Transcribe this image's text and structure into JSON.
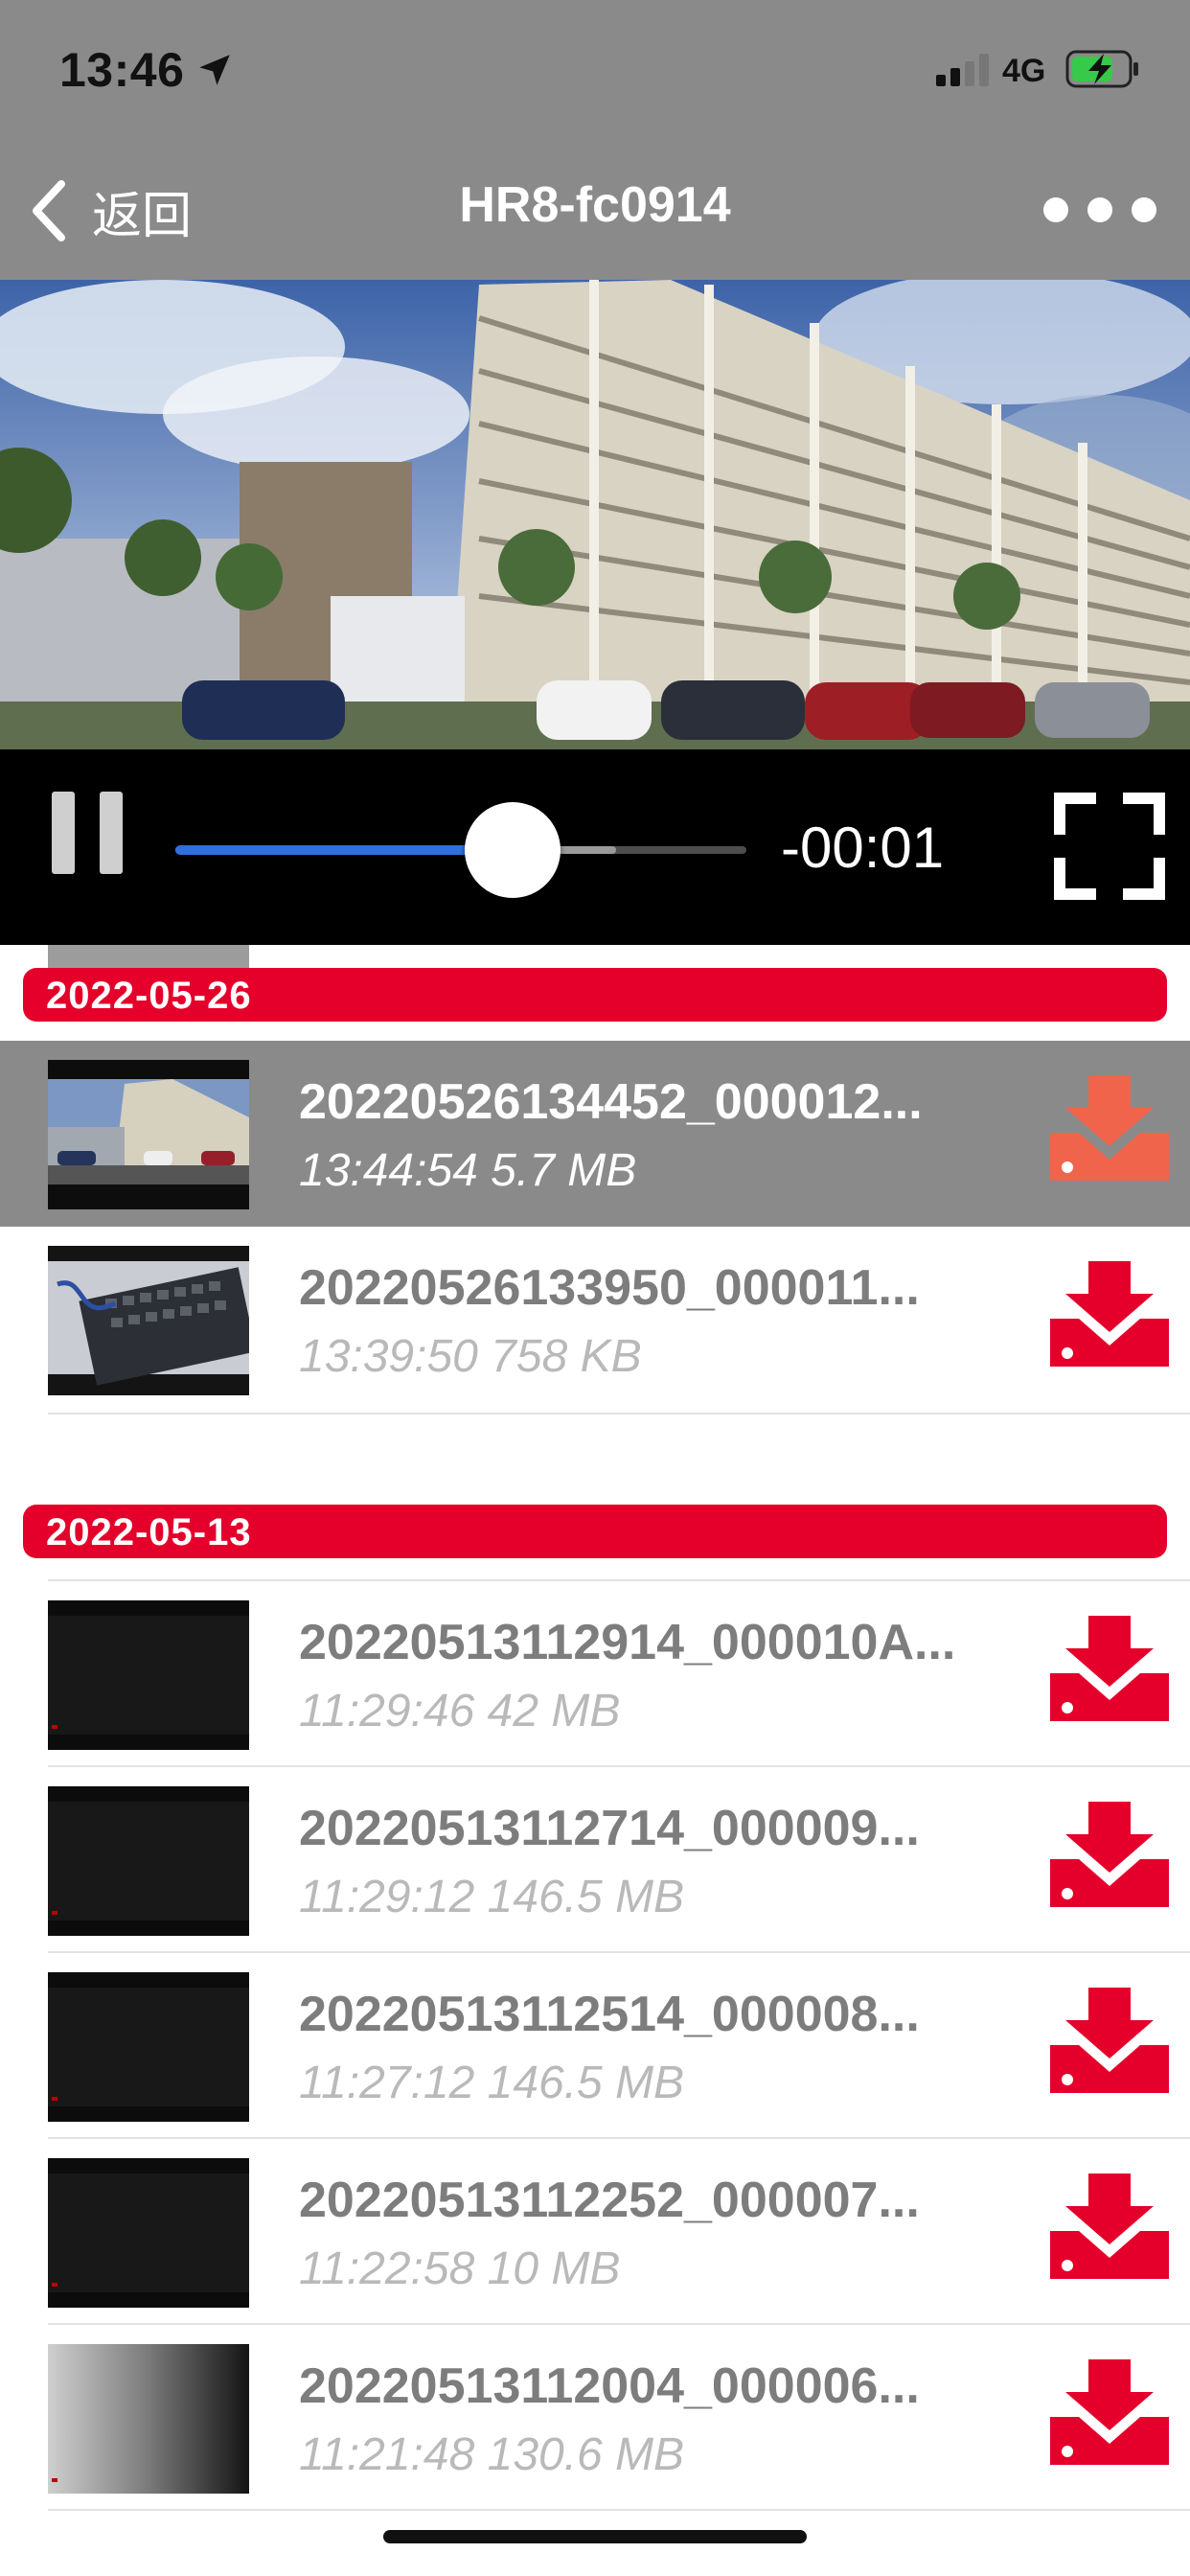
{
  "status": {
    "time": "13:46",
    "network": "4G"
  },
  "nav": {
    "back_label": "返回",
    "title": "HR8-fc0914"
  },
  "player": {
    "time_remaining": "-00:01",
    "progress": 0.62,
    "buffered": 0.77,
    "state": "playing"
  },
  "groups": [
    {
      "date": "2022-05-26",
      "items": [
        {
          "name": "20220526134452_000012...",
          "meta": "13:44:54 5.7 MB",
          "selected": true,
          "thumb": "building"
        },
        {
          "name": "20220526133950_000011...",
          "meta": "13:39:50 758 KB",
          "selected": false,
          "thumb": "keyboard"
        }
      ]
    },
    {
      "date": "2022-05-13",
      "items": [
        {
          "name": "20220513112914_000010A...",
          "meta": "11:29:46 42 MB",
          "selected": false,
          "thumb": "dark"
        },
        {
          "name": "20220513112714_000009...",
          "meta": "11:29:12 146.5 MB",
          "selected": false,
          "thumb": "dark"
        },
        {
          "name": "20220513112514_000008...",
          "meta": "11:27:12 146.5 MB",
          "selected": false,
          "thumb": "dark"
        },
        {
          "name": "20220513112252_000007...",
          "meta": "11:22:58 10 MB",
          "selected": false,
          "thumb": "dark"
        },
        {
          "name": "20220513112004_000006...",
          "meta": "11:21:48 130.6 MB",
          "selected": false,
          "thumb": "gray"
        }
      ]
    }
  ],
  "colors": {
    "accent": "#e4002b",
    "download_selected": "#f0644c",
    "nav_bg": "#8a8a8a",
    "progress": "#2f6fe0"
  },
  "icons": {
    "back": "chevron-left-icon",
    "more": "more-dots-icon",
    "pause": "pause-icon",
    "fullscreen": "fullscreen-icon",
    "download": "download-icon",
    "location": "location-arrow-icon"
  }
}
